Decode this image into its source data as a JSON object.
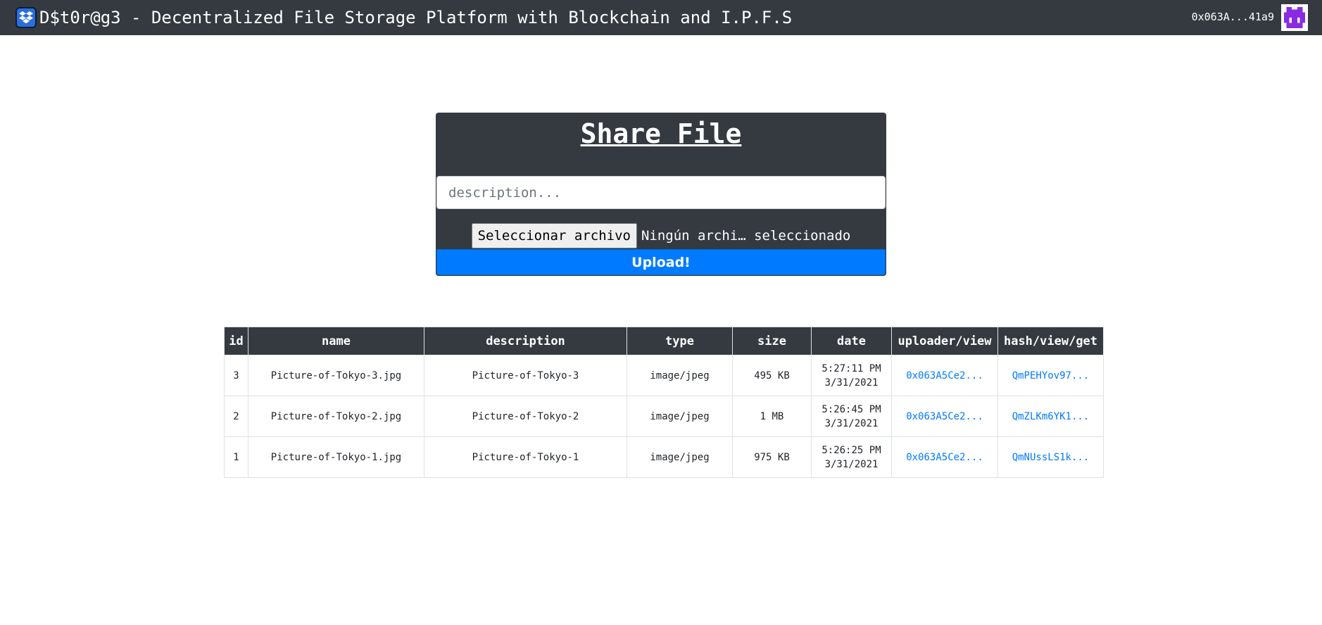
{
  "navbar": {
    "title": "D$t0r@g3 - Decentralized File Storage Platform with Blockchain and I.P.F.S",
    "logo_icon": "dropbox-icon",
    "account": "0x063A...41a9",
    "avatar_icon": "identicon-avatar"
  },
  "share": {
    "title": "Share File",
    "description_placeholder": "description...",
    "file_button": "Seleccionar archivo",
    "file_status": "Ningún archi… seleccionado",
    "upload_label": "Upload!"
  },
  "table": {
    "headers": [
      "id",
      "name",
      "description",
      "type",
      "size",
      "date",
      "uploader/view",
      "hash/view/get"
    ],
    "rows": [
      {
        "id": "3",
        "name": "Picture-of-Tokyo-3.jpg",
        "description": "Picture-of-Tokyo-3",
        "type": "image/jpeg",
        "size": "495 KB",
        "time": "5:27:11 PM",
        "date": "3/31/2021",
        "uploader": "0x063A5Ce2...",
        "hash": "QmPEHYov97..."
      },
      {
        "id": "2",
        "name": "Picture-of-Tokyo-2.jpg",
        "description": "Picture-of-Tokyo-2",
        "type": "image/jpeg",
        "size": "1 MB",
        "time": "5:26:45 PM",
        "date": "3/31/2021",
        "uploader": "0x063A5Ce2...",
        "hash": "QmZLKm6YK1..."
      },
      {
        "id": "1",
        "name": "Picture-of-Tokyo-1.jpg",
        "description": "Picture-of-Tokyo-1",
        "type": "image/jpeg",
        "size": "975 KB",
        "time": "5:26:25 PM",
        "date": "3/31/2021",
        "uploader": "0x063A5Ce2...",
        "hash": "QmNUssLS1k..."
      }
    ]
  },
  "colors": {
    "navbar_bg": "#343a40",
    "primary": "#007bff",
    "avatar": "#8a2be2"
  }
}
